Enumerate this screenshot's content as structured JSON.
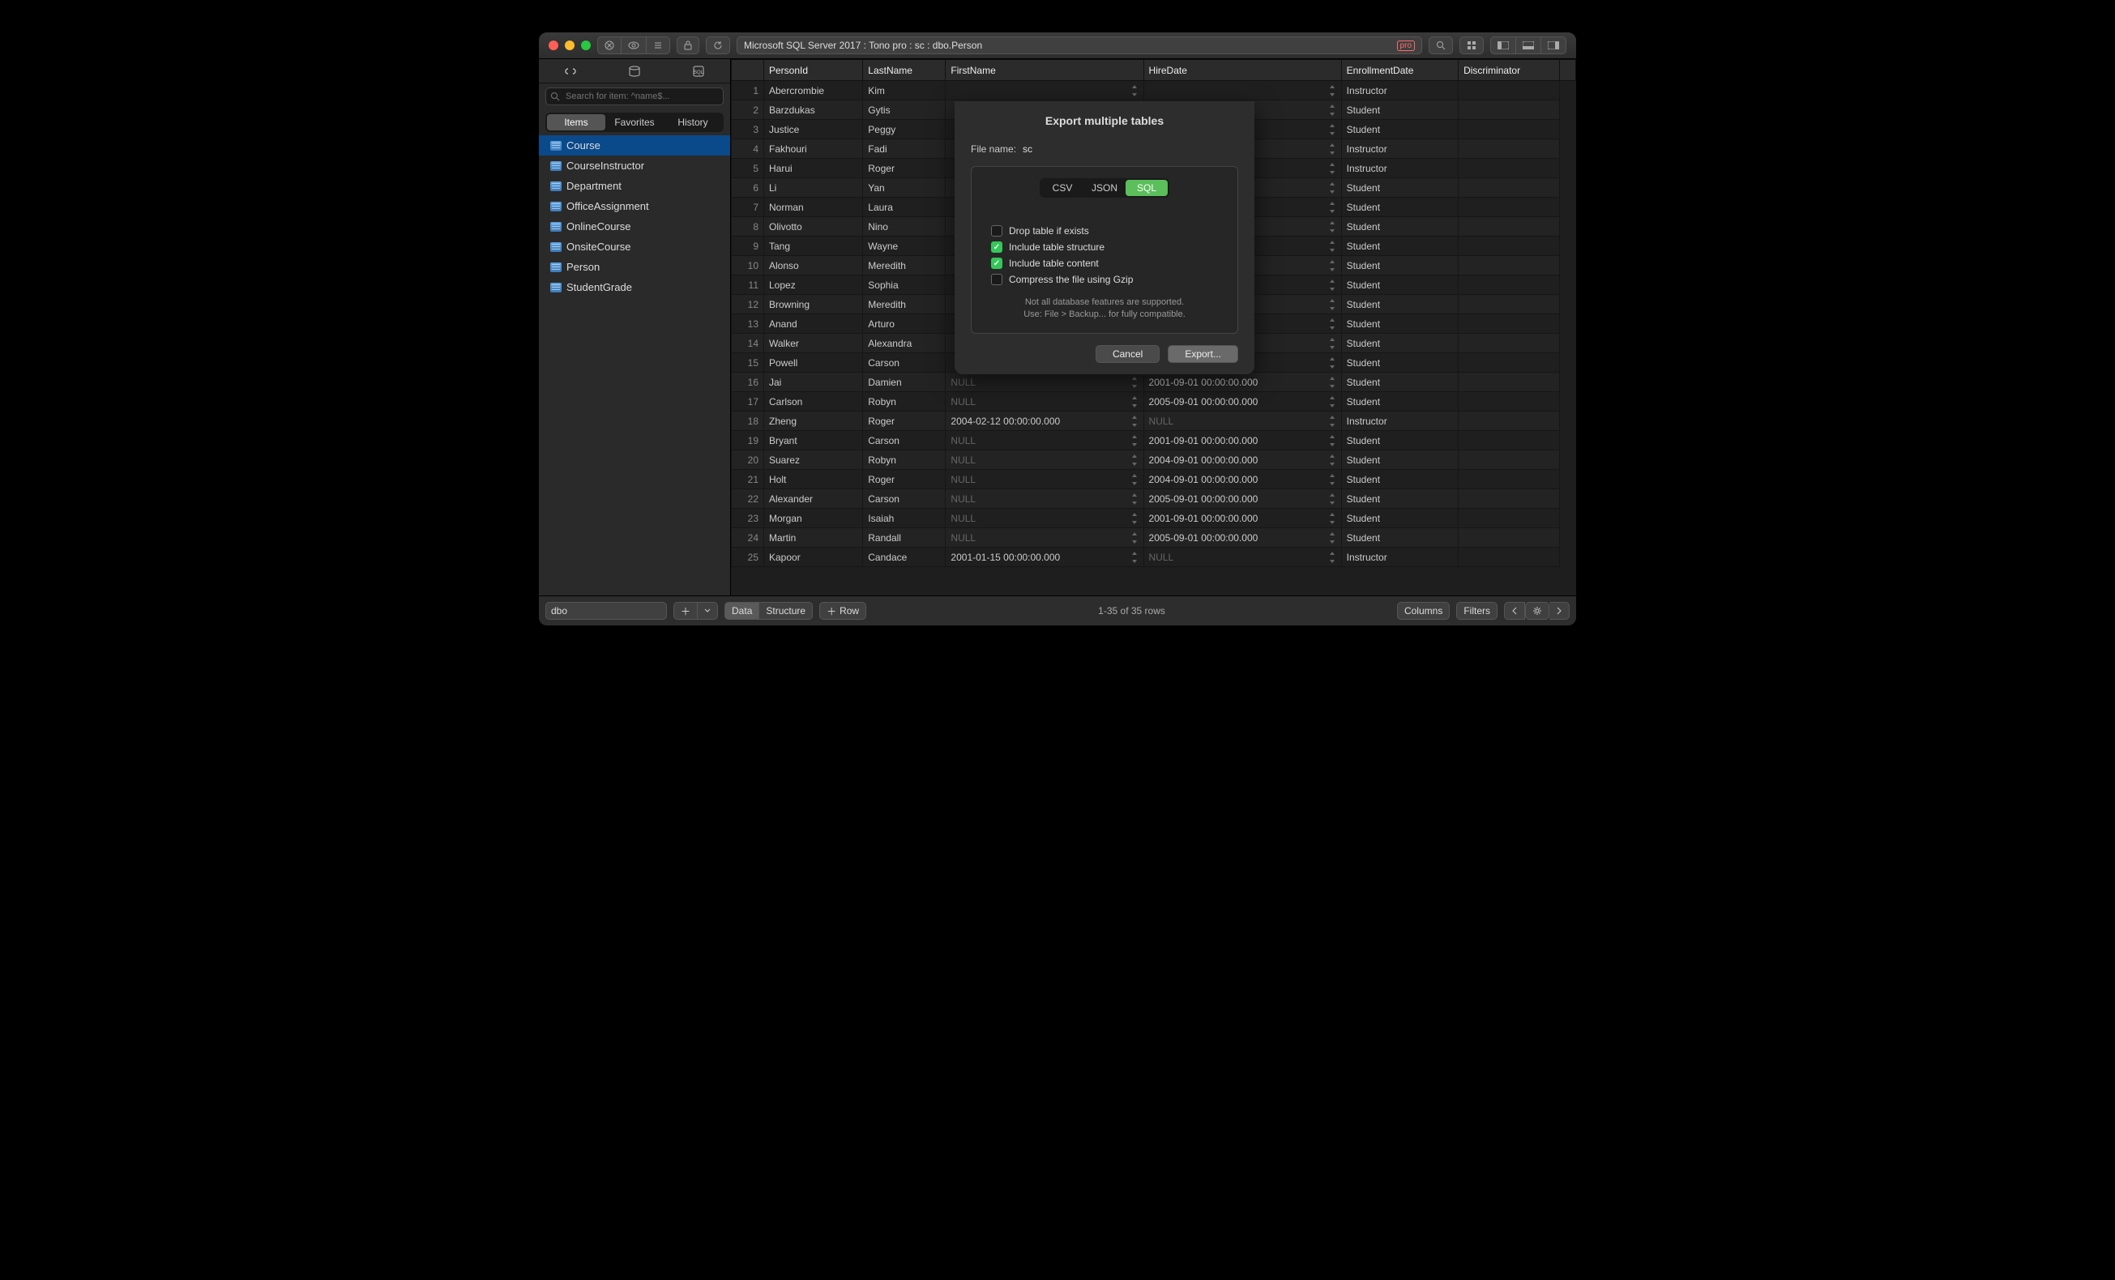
{
  "titlebar": {
    "address": "Microsoft SQL Server 2017 : Tono pro : sc : dbo.Person",
    "pro_badge": "pro"
  },
  "sidebar": {
    "filter_placeholder": "Search for item: ^name$...",
    "segments": {
      "items": "Items",
      "favorites": "Favorites",
      "history": "History"
    },
    "tables": [
      "Course",
      "CourseInstructor",
      "Department",
      "OfficeAssignment",
      "OnlineCourse",
      "OnsiteCourse",
      "Person",
      "StudentGrade"
    ],
    "selected": "Course"
  },
  "columns": [
    "PersonId",
    "LastName",
    "FirstName",
    "HireDate",
    "EnrollmentDate",
    "Discriminator"
  ],
  "rows": [
    {
      "id": "1",
      "last": "Abercrombie",
      "first": "Kim",
      "hire": null,
      "enroll": null,
      "disc": "Instructor"
    },
    {
      "id": "2",
      "last": "Barzdukas",
      "first": "Gytis",
      "hire": null,
      "enroll": null,
      "disc": "Student"
    },
    {
      "id": "3",
      "last": "Justice",
      "first": "Peggy",
      "hire": null,
      "enroll": null,
      "disc": "Student"
    },
    {
      "id": "4",
      "last": "Fakhouri",
      "first": "Fadi",
      "hire": null,
      "enroll": null,
      "disc": "Instructor"
    },
    {
      "id": "5",
      "last": "Harui",
      "first": "Roger",
      "hire": null,
      "enroll": null,
      "disc": "Instructor"
    },
    {
      "id": "6",
      "last": "Li",
      "first": "Yan",
      "hire": null,
      "enroll": null,
      "disc": "Student"
    },
    {
      "id": "7",
      "last": "Norman",
      "first": "Laura",
      "hire": null,
      "enroll": null,
      "disc": "Student"
    },
    {
      "id": "8",
      "last": "Olivotto",
      "first": "Nino",
      "hire": null,
      "enroll": null,
      "disc": "Student"
    },
    {
      "id": "9",
      "last": "Tang",
      "first": "Wayne",
      "hire": null,
      "enroll": null,
      "disc": "Student"
    },
    {
      "id": "10",
      "last": "Alonso",
      "first": "Meredith",
      "hire": null,
      "enroll": null,
      "disc": "Student"
    },
    {
      "id": "11",
      "last": "Lopez",
      "first": "Sophia",
      "hire": null,
      "enroll": null,
      "disc": "Student"
    },
    {
      "id": "12",
      "last": "Browning",
      "first": "Meredith",
      "hire": null,
      "enroll": null,
      "disc": "Student"
    },
    {
      "id": "13",
      "last": "Anand",
      "first": "Arturo",
      "hire": null,
      "enroll": null,
      "disc": "Student"
    },
    {
      "id": "14",
      "last": "Walker",
      "first": "Alexandra",
      "hire": null,
      "enroll": null,
      "disc": "Student"
    },
    {
      "id": "15",
      "last": "Powell",
      "first": "Carson",
      "hire": null,
      "enroll": null,
      "disc": "Student"
    },
    {
      "id": "16",
      "last": "Jai",
      "first": "Damien",
      "hire": "NULL",
      "enroll": "2001-09-01 00:00:00.000",
      "disc": "Student"
    },
    {
      "id": "17",
      "last": "Carlson",
      "first": "Robyn",
      "hire": "NULL",
      "enroll": "2005-09-01 00:00:00.000",
      "disc": "Student"
    },
    {
      "id": "18",
      "last": "Zheng",
      "first": "Roger",
      "hire": "2004-02-12 00:00:00.000",
      "enroll": "NULL",
      "disc": "Instructor"
    },
    {
      "id": "19",
      "last": "Bryant",
      "first": "Carson",
      "hire": "NULL",
      "enroll": "2001-09-01 00:00:00.000",
      "disc": "Student"
    },
    {
      "id": "20",
      "last": "Suarez",
      "first": "Robyn",
      "hire": "NULL",
      "enroll": "2004-09-01 00:00:00.000",
      "disc": "Student"
    },
    {
      "id": "21",
      "last": "Holt",
      "first": "Roger",
      "hire": "NULL",
      "enroll": "2004-09-01 00:00:00.000",
      "disc": "Student"
    },
    {
      "id": "22",
      "last": "Alexander",
      "first": "Carson",
      "hire": "NULL",
      "enroll": "2005-09-01 00:00:00.000",
      "disc": "Student"
    },
    {
      "id": "23",
      "last": "Morgan",
      "first": "Isaiah",
      "hire": "NULL",
      "enroll": "2001-09-01 00:00:00.000",
      "disc": "Student"
    },
    {
      "id": "24",
      "last": "Martin",
      "first": "Randall",
      "hire": "NULL",
      "enroll": "2005-09-01 00:00:00.000",
      "disc": "Student"
    },
    {
      "id": "25",
      "last": "Kapoor",
      "first": "Candace",
      "hire": "2001-01-15 00:00:00.000",
      "enroll": "NULL",
      "disc": "Instructor"
    }
  ],
  "footer": {
    "schema": "dbo",
    "data": "Data",
    "structure": "Structure",
    "row": "Row",
    "status": "1-35 of 35 rows",
    "columns": "Columns",
    "filters": "Filters"
  },
  "dialog": {
    "title": "Export multiple tables",
    "filename_label": "File name:",
    "filename_value": "sc",
    "formats": {
      "csv": "CSV",
      "json": "JSON",
      "sql": "SQL"
    },
    "opts": {
      "drop": "Drop table if exists",
      "structure": "Include table structure",
      "content": "Include table content",
      "gzip": "Compress the file using Gzip"
    },
    "note1": "Not all database features are supported.",
    "note2": "Use: File > Backup... for fully compatible.",
    "cancel": "Cancel",
    "export": "Export..."
  }
}
